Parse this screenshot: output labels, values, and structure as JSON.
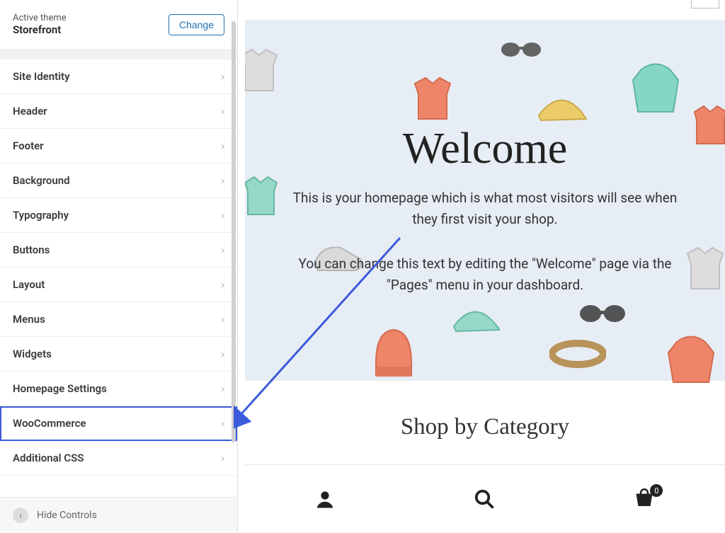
{
  "theme": {
    "active_label": "Active theme",
    "name": "Storefront",
    "change_label": "Change"
  },
  "menu": {
    "items": [
      {
        "label": "Site Identity"
      },
      {
        "label": "Header"
      },
      {
        "label": "Footer"
      },
      {
        "label": "Background"
      },
      {
        "label": "Typography"
      },
      {
        "label": "Buttons"
      },
      {
        "label": "Layout"
      },
      {
        "label": "Menus"
      },
      {
        "label": "Widgets"
      },
      {
        "label": "Homepage Settings"
      },
      {
        "label": "WooCommerce"
      },
      {
        "label": "Additional CSS"
      }
    ],
    "highlight_index": 10
  },
  "hide_controls_label": "Hide Controls",
  "preview": {
    "hero_title": "Welcome",
    "hero_p1": "This is your homepage which is what most visitors will see when they first visit your shop.",
    "hero_p2": "You can change this text by editing the \"Welcome\" page via the \"Pages\" menu in your dashboard.",
    "section_title": "Shop by Category",
    "cart_badge": "0"
  }
}
